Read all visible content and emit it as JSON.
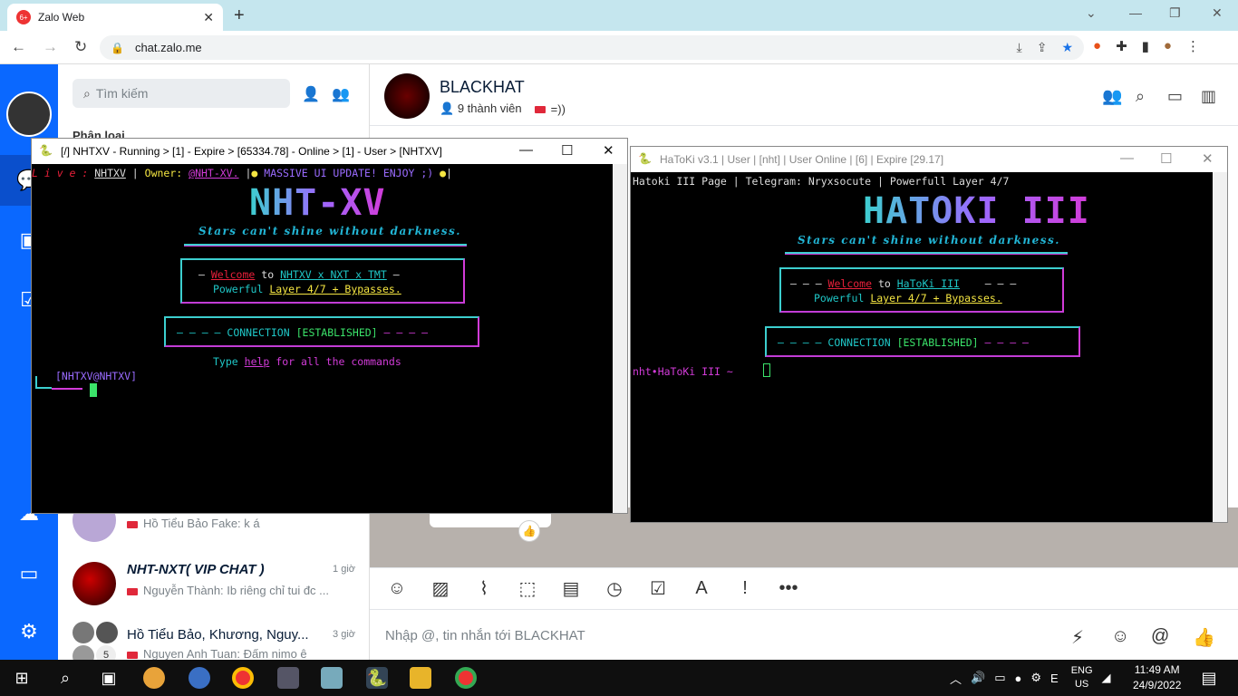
{
  "browser": {
    "tab_title": "Zalo Web",
    "tab_badge": "6+",
    "url": "chat.zalo.me"
  },
  "zalo": {
    "search_placeholder": "Tìm kiếm",
    "section_label": "Phân loại",
    "conversations": [
      {
        "name": "",
        "msg_sender": "Hồ Tiểu Bảo Fake: k á",
        "time": ""
      },
      {
        "name": "NHT-NXT( VIP CHAT )",
        "msg_sender": "Nguyễn Thành: Ib riêng chỉ tui đc ...",
        "time": "1 giờ"
      },
      {
        "name": "Hồ Tiểu Bảo, Khương, Nguy...",
        "msg_sender": "Nguyen Anh Tuan: Đấm nimo ê",
        "time": "3 giờ",
        "count": "5"
      }
    ],
    "chat": {
      "group_name": "BLACKHAT",
      "members": "9 thành viên",
      "tag_label": "=))",
      "input_placeholder": "Nhập @, tin nhắn tới BLACKHAT"
    }
  },
  "console1": {
    "title": "[/] NHTXV - Running > [1] - Expire > [65334.78] - Online > [1] - User > [NHTXV]",
    "live_label": "L i v e :",
    "live_user": "NHTXV",
    "owner_label": "Owner:",
    "owner": "@NHT-XV.",
    "update_msg": "MASSIVE UI UPDATE! ENJOY ;)",
    "logo": "NHT-XV",
    "tagline": "Stars can't shine without darkness.",
    "welcome": "Welcome",
    "to": "to",
    "product": "NHTXV x NXT x TMT",
    "powerful": "Powerful",
    "layers": "Layer 4/7 + Bypasses.",
    "conn_prefix": "— — — —",
    "conn_word": "CONNECTION",
    "conn_status": "[ESTABLISHED]",
    "conn_suffix": "— — — —",
    "help_pre": "Type",
    "help_word": "help",
    "help_post": "for all the commands",
    "prompt": "[NHTXV@NHTXV]"
  },
  "console2": {
    "title": "HaToKi v3.1 | User | [nht] | User Online | [6] | Expire [29.17]",
    "header": "Hatoki III Page | Telegram: Nryxsocute | Powerfull Layer 4/7",
    "logo": "HATOKI III",
    "tagline": "Stars can't shine without darkness.",
    "welcome": "Welcome",
    "to": "to",
    "product": "HaToKi III",
    "powerful": "Powerful",
    "layers": "Layer 4/7 + Bypasses.",
    "conn_word": "CONNECTION",
    "conn_status": "[ESTABLISHED]",
    "prompt": "nht•HaToKi III ~"
  },
  "taskbar": {
    "lang1": "ENG",
    "lang2": "US",
    "time": "11:49 AM",
    "date": "24/9/2022"
  }
}
